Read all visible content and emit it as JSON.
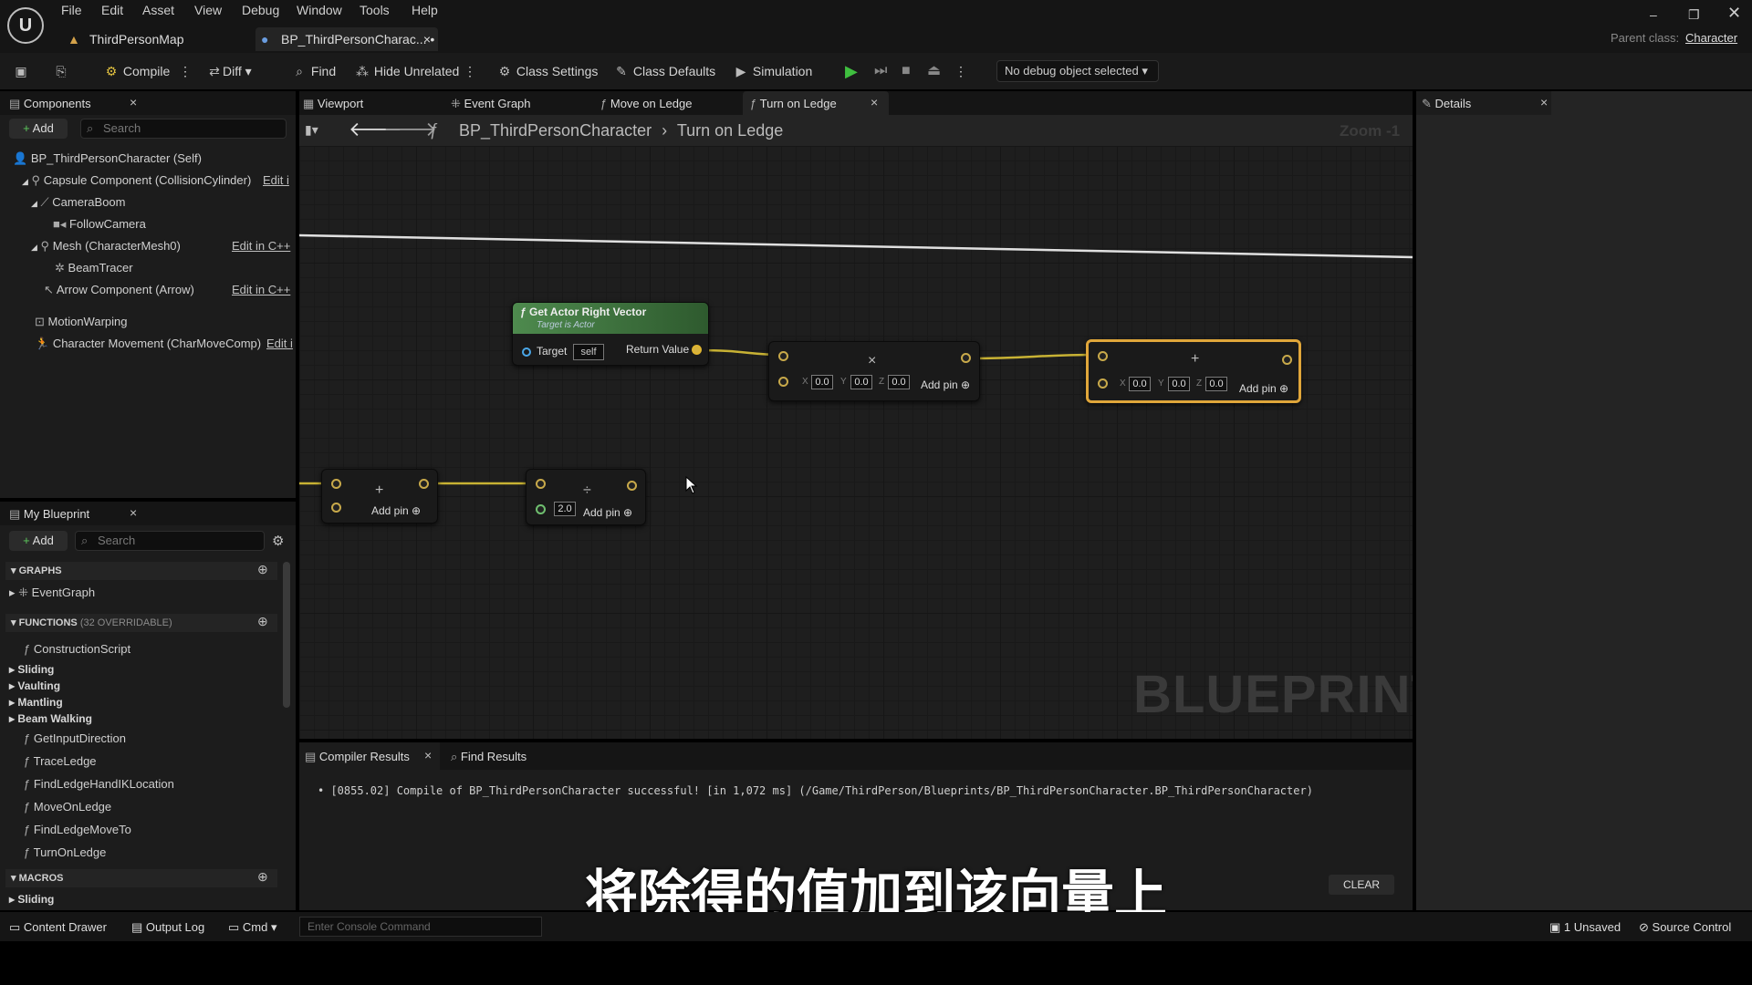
{
  "menu": [
    "File",
    "Edit",
    "Asset",
    "View",
    "Debug",
    "Window",
    "Tools",
    "Help"
  ],
  "doc_tabs": [
    "ThirdPersonMap",
    "BP_ThirdPersonCharac... •"
  ],
  "parent_class": {
    "label": "Parent class:",
    "value": "Character"
  },
  "toolbar": {
    "compile": "Compile",
    "diff": "Diff",
    "find": "Find",
    "hide_unrelated": "Hide Unrelated",
    "class_settings": "Class Settings",
    "class_defaults": "Class Defaults",
    "simulation": "Simulation",
    "debug_object": "No debug object selected"
  },
  "components": {
    "tab": "Components",
    "add": "Add",
    "search_placeholder": "Search",
    "items": [
      {
        "label": "BP_ThirdPersonCharacter (Self)"
      },
      {
        "label": "Capsule Component (CollisionCylinder)",
        "edit": "Edit i"
      },
      {
        "label": "CameraBoom"
      },
      {
        "label": "FollowCamera"
      },
      {
        "label": "Mesh (CharacterMesh0)",
        "edit": "Edit in C++"
      },
      {
        "label": "BeamTracer"
      },
      {
        "label": "Arrow Component (Arrow)",
        "edit": "Edit in C++"
      },
      {
        "label": "MotionWarping"
      },
      {
        "label": "Character Movement (CharMoveComp)",
        "edit": "Edit i"
      }
    ]
  },
  "graph_tabs": [
    "Viewport",
    "Event Graph",
    "Move on Ledge",
    "Turn on Ledge"
  ],
  "breadcrumb": {
    "blueprint": "BP_ThirdPersonCharacter",
    "graph": "Turn on Ledge",
    "zoom": "Zoom -1"
  },
  "watermark": "BLUEPRINT",
  "nodes": {
    "get_right": {
      "title": "Get Actor Right Vector",
      "subtitle": "Target is Actor",
      "target": "Target",
      "self": "self",
      "return": "Return Value"
    },
    "multiply": {
      "x": "0.0",
      "y": "0.0",
      "z": "0.0",
      "add_pin": "Add pin"
    },
    "add_vector": {
      "x": "0.0",
      "y": "0.0",
      "z": "0.0",
      "add_pin": "Add pin"
    },
    "add_float": {
      "add_pin": "Add pin"
    },
    "divide": {
      "value": "2.0",
      "add_pin": "Add pin"
    }
  },
  "my_blueprint": {
    "tab": "My Blueprint",
    "add": "Add",
    "search_placeholder": "Search",
    "graphs_header": "GRAPHS",
    "event_graph": "EventGraph",
    "functions_header": "FUNCTIONS",
    "functions_note": "(32 OVERRIDABLE)",
    "functions": [
      "ConstructionScript"
    ],
    "categories": [
      "Sliding",
      "Vaulting",
      "Mantling",
      "Beam Walking"
    ],
    "functions2": [
      "GetInputDirection",
      "TraceLedge",
      "FindLedgeHandIKLocation",
      "MoveOnLedge",
      "FindLedgeMoveTo",
      "TurnOnLedge"
    ],
    "macros_header": "MACROS",
    "macros": [
      "Sliding"
    ]
  },
  "details": {
    "tab": "Details"
  },
  "bottom_tabs": {
    "compiler": "Compiler Results",
    "find": "Find Results"
  },
  "compiler_message": "[0855.02] Compile of BP_ThirdPersonCharacter successful! [in 1,072 ms] (/Game/ThirdPerson/Blueprints/BP_ThirdPersonCharacter.BP_ThirdPersonCharacter)",
  "clear": "CLEAR",
  "subtitle": "将除得的值加到该向量上",
  "status_bar": {
    "content_drawer": "Content Drawer",
    "output_log": "Output Log",
    "cmd": "Cmd",
    "console_placeholder": "Enter Console Command",
    "unsaved": "1 Unsaved",
    "source_control": "Source Control"
  }
}
